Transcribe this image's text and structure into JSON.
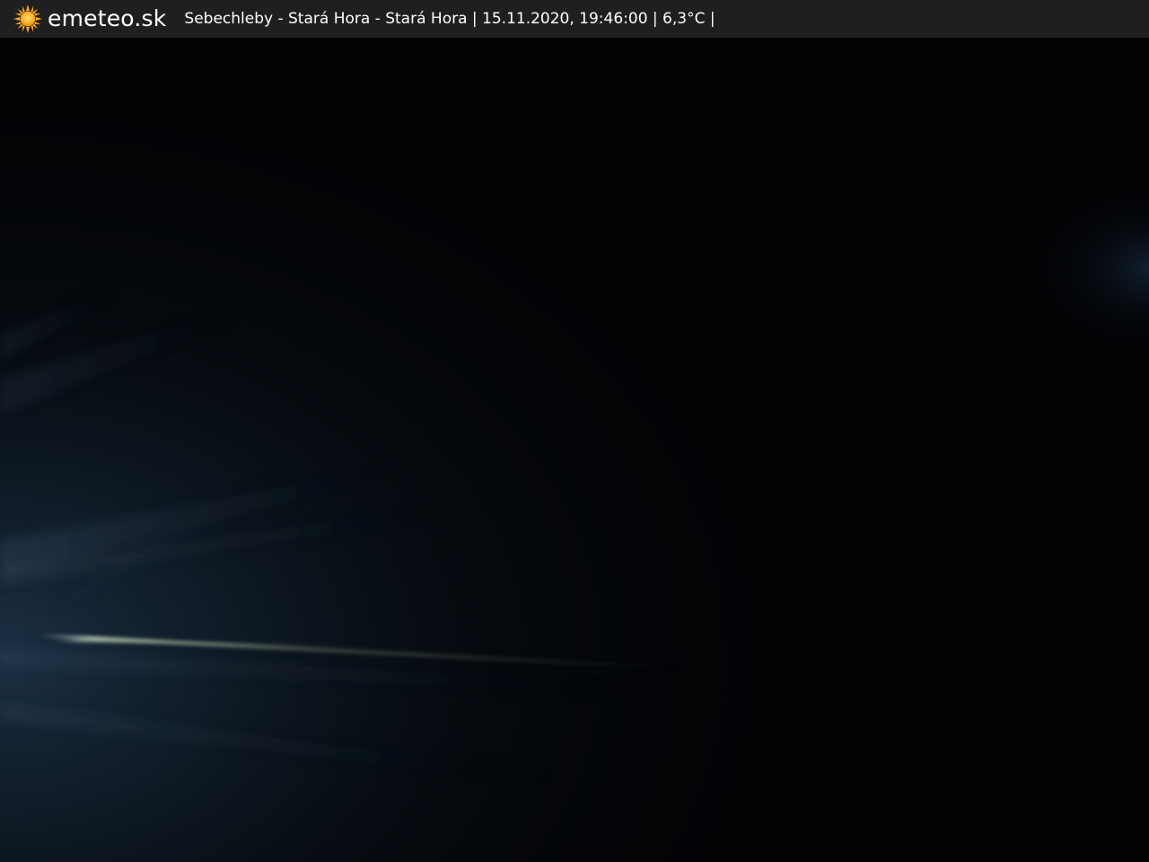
{
  "header": {
    "brand": "emeteo.sk",
    "logo_icon": "sun-icon",
    "logo_color": "#f6a623",
    "background": "#1f1f1f",
    "caption": "Sebechleby - Stará Hora - Stará Hora | 15.11.2020, 19:46:00 | 6,3°C |"
  },
  "scene": {
    "background": "#020305"
  }
}
